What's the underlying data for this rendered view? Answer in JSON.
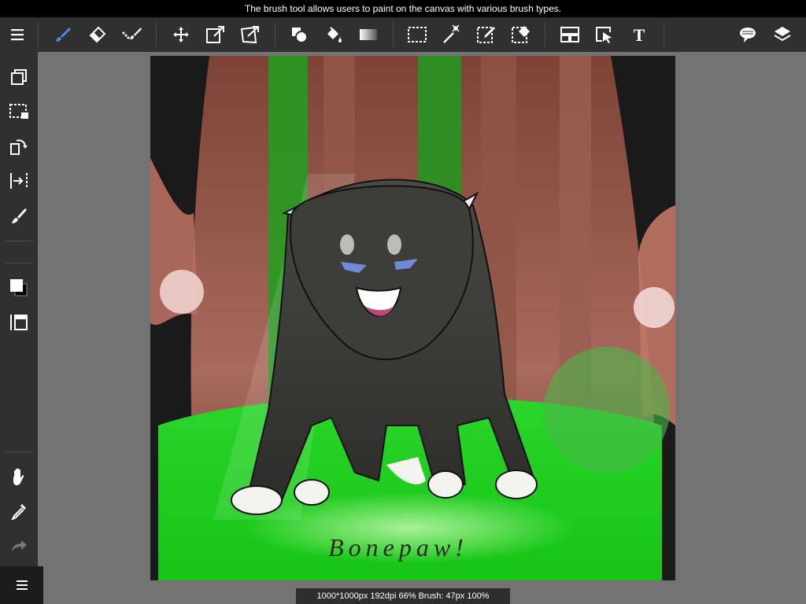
{
  "tooltip": "The brush tool allows users to paint on the canvas with various brush types.",
  "toolbar": {
    "tools": [
      {
        "name": "menu-icon",
        "label": "Menu"
      },
      {
        "name": "brush-icon",
        "label": "Brush",
        "active": true
      },
      {
        "name": "eraser-icon",
        "label": "Eraser"
      },
      {
        "name": "smudge-icon",
        "label": "Smudge"
      },
      {
        "name": "move-icon",
        "label": "Move"
      },
      {
        "name": "transform-icon",
        "label": "Transform"
      },
      {
        "name": "free-transform-icon",
        "label": "Free Transform"
      },
      {
        "name": "fill-shape-icon",
        "label": "Fill"
      },
      {
        "name": "bucket-icon",
        "label": "Bucket"
      },
      {
        "name": "gradient-icon",
        "label": "Gradient"
      },
      {
        "name": "select-rect-icon",
        "label": "Select"
      },
      {
        "name": "magic-wand-icon",
        "label": "Magic Wand"
      },
      {
        "name": "select-pen-icon",
        "label": "Select Pen"
      },
      {
        "name": "select-eraser-icon",
        "label": "Select Eraser"
      },
      {
        "name": "panel-icon",
        "label": "Panel"
      },
      {
        "name": "operation-icon",
        "label": "Operation"
      },
      {
        "name": "text-icon",
        "label": "Text"
      },
      {
        "name": "speech-bubble-icon",
        "label": "Materials"
      },
      {
        "name": "layers-icon",
        "label": "Layers"
      }
    ]
  },
  "sidebar": {
    "items": [
      {
        "name": "layer-copy-icon"
      },
      {
        "name": "selection-icon"
      },
      {
        "name": "rotate-icon"
      },
      {
        "name": "flip-icon"
      },
      {
        "name": "brush-size-icon"
      },
      {
        "name": "color-swatch-icon"
      },
      {
        "name": "layer-panel-icon"
      },
      {
        "name": "hand-icon"
      },
      {
        "name": "eyedropper-icon"
      },
      {
        "name": "redo-icon"
      }
    ]
  },
  "canvas": {
    "caption": "Bonepaw!"
  },
  "status": "1000*1000px 192dpi 66% Brush: 47px 100%",
  "colors": {
    "accent": "#4a90d9",
    "toolbar_bg": "#303030",
    "workspace_bg": "#737373",
    "grass": "#1fd61f",
    "tree": "#8a4a3c"
  }
}
